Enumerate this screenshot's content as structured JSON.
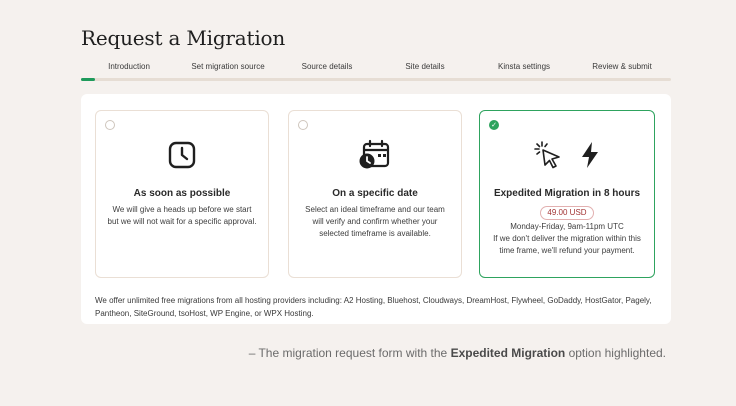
{
  "page": {
    "title": "Request a Migration"
  },
  "tabs": [
    {
      "label": "Introduction"
    },
    {
      "label": "Set migration source"
    },
    {
      "label": "Source details"
    },
    {
      "label": "Site details"
    },
    {
      "label": "Kinsta settings"
    },
    {
      "label": "Review & submit"
    }
  ],
  "options": [
    {
      "title": "As soon as possible",
      "description": "We will give a heads up before we start but we will not wait for a specific approval.",
      "selected": false,
      "icons": [
        "clock-icon"
      ]
    },
    {
      "title": "On a specific date",
      "description": "Select an ideal timeframe and our team will verify and confirm whether your selected timeframe is available.",
      "selected": false,
      "icons": [
        "calendar-clock-icon"
      ]
    },
    {
      "title": "Expedited Migration in 8 hours",
      "price": "49.00 USD",
      "hours": "Monday-Friday, 9am-11pm UTC",
      "description": "If we don't deliver the migration within this time frame, we'll refund your payment.",
      "selected": true,
      "icons": [
        "cursor-click-icon",
        "lightning-icon"
      ]
    }
  ],
  "footnote": "We offer unlimited free migrations from all hosting providers including: A2 Hosting, Bluehost, Cloudways, DreamHost, Flywheel, GoDaddy, HostGator, Pagely, Pantheon, SiteGround, tsoHost, WP Engine, or WPX Hosting.",
  "caption": {
    "prefix": "– The migration request form with the ",
    "highlight": "Expedited Migration",
    "suffix": " option highlighted."
  },
  "colors": {
    "accent": "#2ea35e",
    "price": "#a23434",
    "background": "#f5f1ee"
  }
}
